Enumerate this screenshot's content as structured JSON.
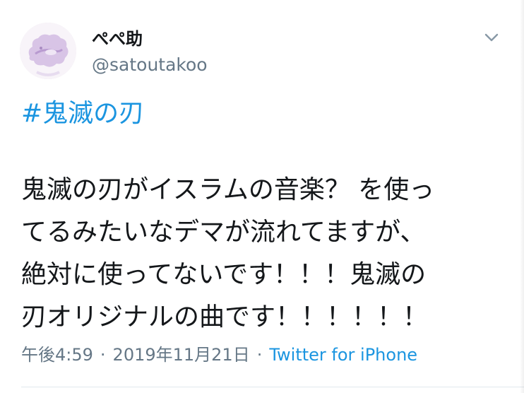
{
  "tweet": {
    "author": {
      "display_name": "ぺぺ助",
      "handle": "@satoutakoo",
      "avatar_icon": "avatar-icon"
    },
    "menu_icon": "chevron-down-icon",
    "hashtag": "#鬼滅の刃",
    "body_lines": [
      "鬼滅の刃がイスラムの音楽？ を使っ",
      "てるみたいなデマが流れてますが、",
      "絶対に使ってないです！！！鬼滅の",
      "刃オリジナルの曲です！！！！！！"
    ],
    "time": "午後4:59",
    "separator": "·",
    "date": "2019年11月21日",
    "source": "Twitter for iPhone"
  },
  "colors": {
    "link": "#1b95e0",
    "secondary_text": "#657786",
    "text": "#14171a"
  }
}
